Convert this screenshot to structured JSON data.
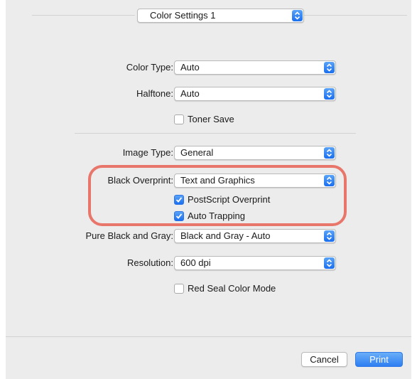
{
  "top_preset": {
    "value": "Color Settings 1"
  },
  "fields": {
    "color_type": {
      "label": "Color Type:",
      "value": "Auto"
    },
    "halftone": {
      "label": "Halftone:",
      "value": "Auto"
    },
    "toner_save": {
      "label": "Toner Save",
      "checked": false
    },
    "image_type": {
      "label": "Image Type:",
      "value": "General"
    },
    "black_overprint": {
      "label": "Black Overprint:",
      "value": "Text and Graphics"
    },
    "postscript_overprint": {
      "label": "PostScript Overprint",
      "checked": true
    },
    "auto_trapping": {
      "label": "Auto Trapping",
      "checked": true
    },
    "pure_black_gray": {
      "label": "Pure Black and Gray:",
      "value": "Black and Gray - Auto"
    },
    "resolution": {
      "label": "Resolution:",
      "value": "600 dpi"
    },
    "red_seal": {
      "label": "Red Seal Color Mode",
      "checked": false
    }
  },
  "buttons": {
    "cancel": "Cancel",
    "print": "Print"
  },
  "colors": {
    "accent": "#1b6ff0",
    "highlight": "#e8766b",
    "panel": "#ececec"
  }
}
